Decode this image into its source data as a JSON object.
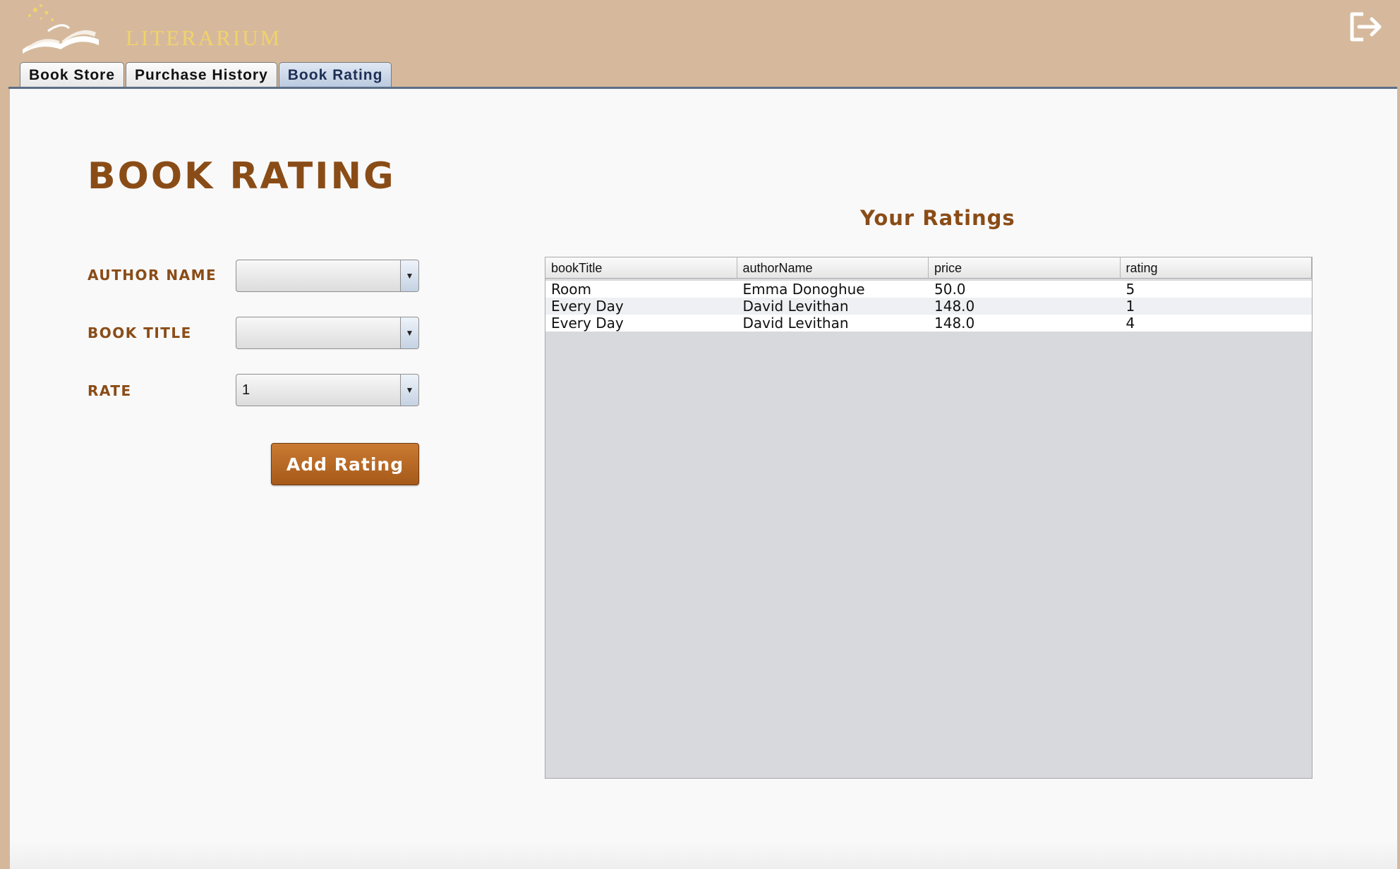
{
  "app": {
    "brand": "LITERARIUM",
    "logout_icon": "logout-icon"
  },
  "tabs": [
    {
      "label": "Book Store",
      "active": false
    },
    {
      "label": "Purchase History",
      "active": false
    },
    {
      "label": "Book Rating",
      "active": true
    }
  ],
  "form": {
    "title": "BOOK RATING",
    "author_label": "AUTHOR NAME",
    "author_value": "",
    "book_label": "BOOK TITLE",
    "book_value": "",
    "rate_label": "RATE",
    "rate_value": "1",
    "submit_label": "Add Rating"
  },
  "ratings": {
    "title": "Your Ratings",
    "columns": [
      "bookTitle",
      "authorName",
      "price",
      "rating"
    ],
    "rows": [
      [
        "Room",
        "Emma Donoghue",
        "50.0",
        "5"
      ],
      [
        "Every Day",
        "David Levithan",
        "148.0",
        "1"
      ],
      [
        "Every Day",
        "David Levithan",
        "148.0",
        "4"
      ]
    ]
  },
  "colors": {
    "header_bg": "#d6b99c",
    "accent_brown": "#8a4c17",
    "button_bg": "#b2621f",
    "brand_yellow": "#f0d36a"
  }
}
